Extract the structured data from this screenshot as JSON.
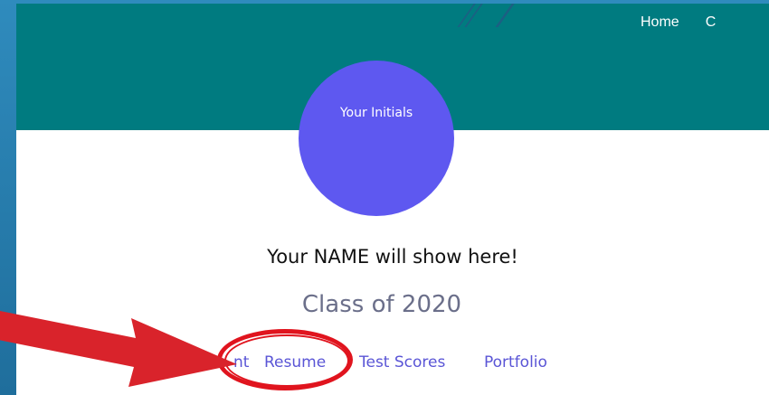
{
  "nav": {
    "items": [
      "Home",
      "C"
    ]
  },
  "profile": {
    "initials": "Your Initials",
    "name": "Your NAME will show here!",
    "class": "Class of 2020"
  },
  "subnav": {
    "items": [
      "nt",
      "Resume",
      "Test Scores",
      "Portfolio"
    ]
  },
  "colors": {
    "header_bg": "#007b80",
    "avatar_bg": "#5e58f0",
    "link": "#5a55d6",
    "highlight": "#e0141e",
    "slide_bg": "#2378a6"
  },
  "icons": {
    "annotation_arrow": "arrow-right-icon",
    "annotation_circle": "highlight-circle"
  }
}
